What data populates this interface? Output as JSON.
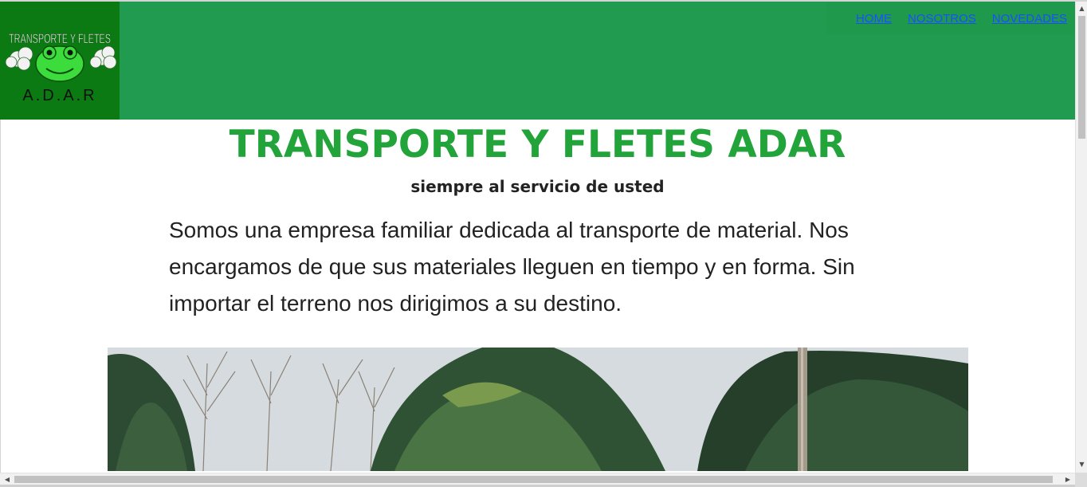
{
  "header": {
    "logo": {
      "top_text": "TRANSPORTE Y FLETES",
      "bottom_text": "A.D.A.R",
      "icon": "frog-truck-logo-icon"
    },
    "nav": [
      {
        "label": "HOME"
      },
      {
        "label": "NOSOTROS"
      },
      {
        "label": "NOVEDADES"
      }
    ]
  },
  "main": {
    "title": "TRANSPORTE Y FLETES ADAR",
    "subtitle": "siempre al servicio de usted",
    "intro": "Somos una empresa familiar dedicada al transporte de material. Nos encargamos de que sus materiales lleguen en tiempo y en forma. Sin importar el terreno nos dirigimos a su destino.",
    "photo_icon": "trees-photo"
  },
  "colors": {
    "header_bg": "#219b4f",
    "logo_bg": "#0b7a12",
    "title": "#22a43a",
    "link": "#1a4fff"
  }
}
